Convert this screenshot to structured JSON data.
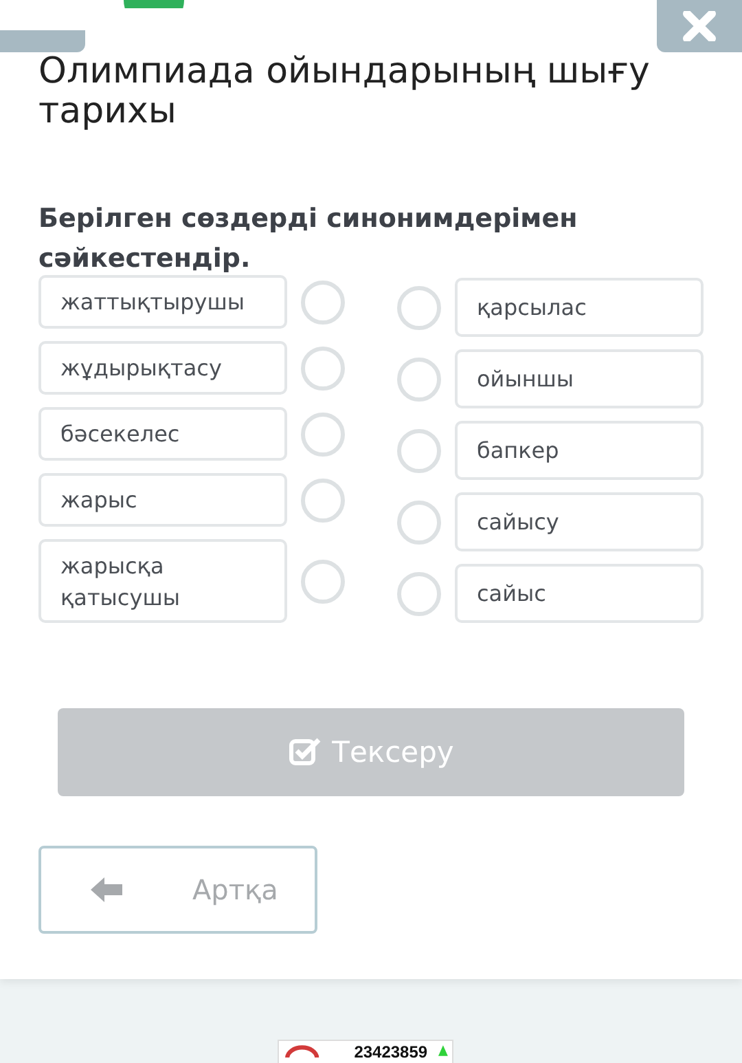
{
  "title": "Олимпиада ойындарының шығу тарихы",
  "instruction": "Берілген сөздерді синонимдерімен сәйкестендір.",
  "left_items": [
    {
      "text": "жаттықтырушы"
    },
    {
      "text": "жұдырықтасу"
    },
    {
      "text": "бәсекелес"
    },
    {
      "text": "жарыс"
    },
    {
      "text": "жарысқа қатысушы"
    }
  ],
  "right_items": [
    {
      "text": "қарсылас"
    },
    {
      "text": "ойыншы"
    },
    {
      "text": "бапкер"
    },
    {
      "text": "сайысу"
    },
    {
      "text": "сайыс"
    }
  ],
  "check_button": {
    "label": "Тексеру",
    "disabled": true
  },
  "back_button": {
    "label": "Артқа"
  },
  "counter": {
    "value": "23423859"
  }
}
